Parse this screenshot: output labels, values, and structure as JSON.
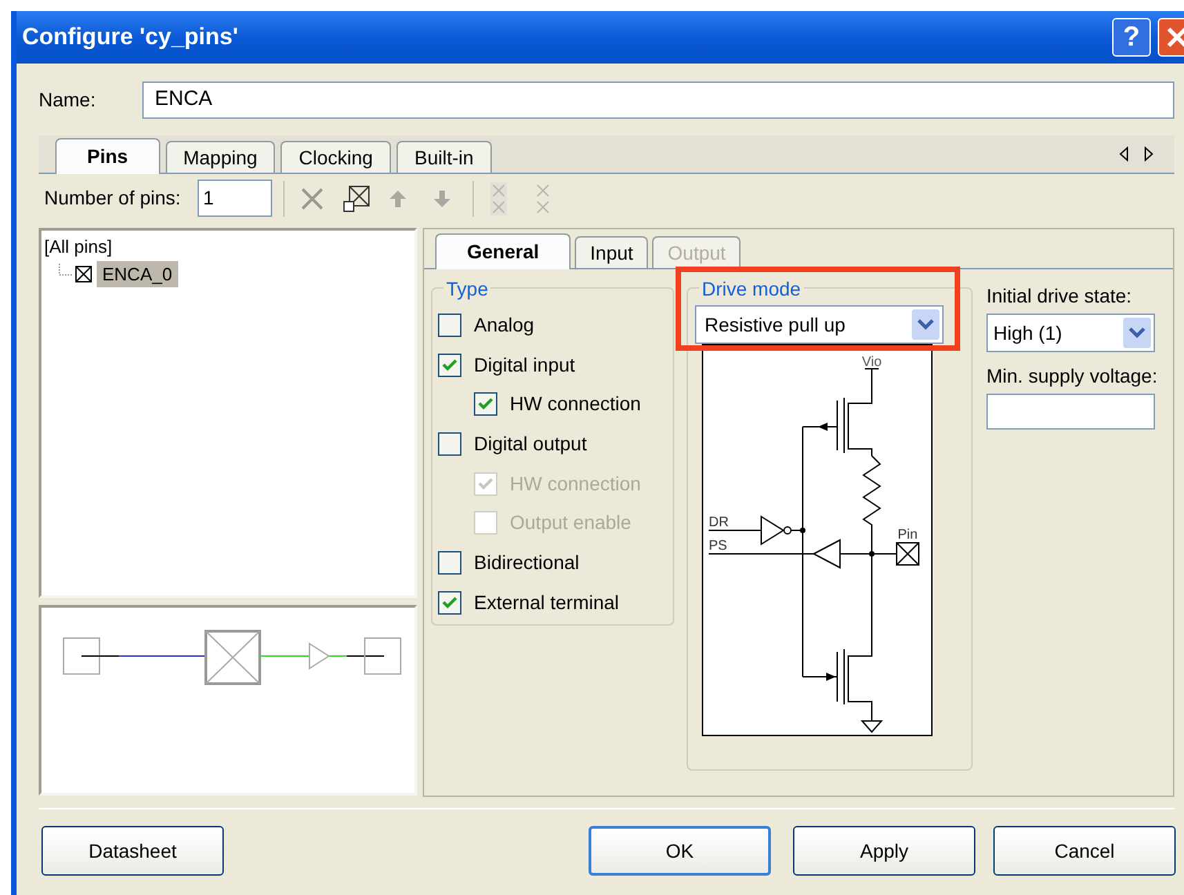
{
  "window": {
    "title": "Configure 'cy_pins'",
    "help": "?"
  },
  "name": {
    "label": "Name:",
    "value": "ENCA"
  },
  "tabs": [
    {
      "label": "Pins",
      "selected": true
    },
    {
      "label": "Mapping",
      "selected": false
    },
    {
      "label": "Clocking",
      "selected": false
    },
    {
      "label": "Built-in",
      "selected": false
    }
  ],
  "toolbar": {
    "label": "Number of pins:",
    "value": "1"
  },
  "tree": {
    "label": "[All pins]",
    "children": [
      {
        "label": "ENCA_0",
        "selected": true
      }
    ]
  },
  "inner_tabs": [
    {
      "label": "General",
      "selected": true,
      "disabled": false
    },
    {
      "label": "Input",
      "selected": false,
      "disabled": false
    },
    {
      "label": "Output",
      "selected": false,
      "disabled": true
    }
  ],
  "type_group": {
    "title": "Type",
    "options": [
      {
        "label": "Analog",
        "checked": false,
        "disabled": false
      },
      {
        "label": "Digital input",
        "checked": true,
        "disabled": false,
        "children": [
          {
            "label": "HW connection",
            "checked": true,
            "disabled": false
          }
        ]
      },
      {
        "label": "Digital output",
        "checked": false,
        "disabled": false,
        "children": [
          {
            "label": "HW connection",
            "checked": true,
            "disabled": true
          },
          {
            "label": "Output enable",
            "checked": false,
            "disabled": true
          }
        ]
      },
      {
        "label": "Bidirectional",
        "checked": false,
        "disabled": false
      },
      {
        "label": "External terminal",
        "checked": true,
        "disabled": false
      }
    ]
  },
  "drive_mode": {
    "title": "Drive mode",
    "value": "Resistive pull up",
    "highlighted": true,
    "schematic": {
      "supply_label": "Vio",
      "input_labels": [
        "DR",
        "PS"
      ],
      "pin_label": "Pin"
    }
  },
  "initial_drive_state": {
    "label": "Initial drive state:",
    "value": "High (1)"
  },
  "min_supply_voltage": {
    "label": "Min. supply voltage:"
  },
  "buttons": [
    {
      "label": "Datasheet",
      "default": false
    },
    {
      "label": "OK",
      "default": true
    },
    {
      "label": "Apply",
      "default": false
    },
    {
      "label": "Cancel",
      "default": false
    }
  ]
}
